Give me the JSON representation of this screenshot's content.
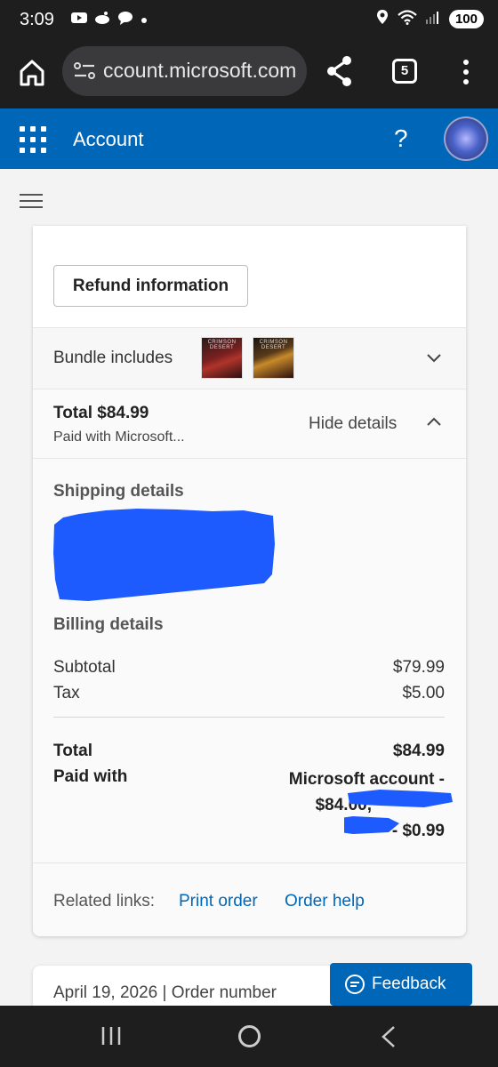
{
  "status_bar": {
    "time": "3:09",
    "battery": "100"
  },
  "browser": {
    "url": "ccount.microsoft.com",
    "tab_count": "5"
  },
  "header": {
    "title": "Account",
    "help": "?"
  },
  "order": {
    "refund_button": "Refund information",
    "bundle_label": "Bundle includes",
    "bundle_items": [
      "CRIMSON DESERT",
      "CRIMSON DESERT"
    ],
    "total_title": "Total $84.99",
    "paid_with_short": "Paid with Microsoft...",
    "hide_details": "Hide details",
    "shipping_title": "Shipping details",
    "billing_title": "Billing details",
    "subtotal_label": "Subtotal",
    "subtotal_value": "$79.99",
    "tax_label": "Tax",
    "tax_value": "$5.00",
    "total_label": "Total",
    "total_value": "$84.99",
    "paid_label": "Paid with",
    "paid_line1": "Microsoft account -",
    "paid_line2": "$84.00,",
    "paid_line3": "- $0.99",
    "related_label": "Related links:",
    "print_link": "Print order",
    "help_link": "Order help"
  },
  "next_order": {
    "text": "April 19, 2026 | Order number"
  },
  "feedback": {
    "label": "Feedback"
  },
  "colors": {
    "accent": "#0067b8",
    "redaction": "#1e5bff"
  }
}
